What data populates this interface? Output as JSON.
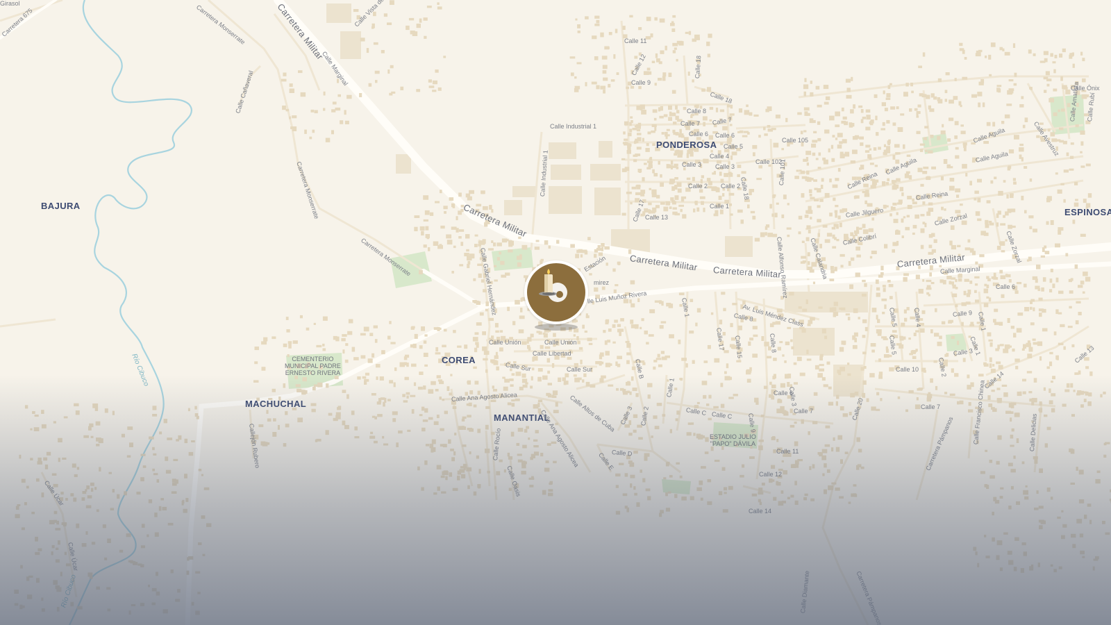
{
  "map": {
    "colors": {
      "land": "#f7f3ea",
      "road": "#ffffff",
      "road_minor": "#efe7d4",
      "building": "#e8dcc4",
      "park": "#d5e6c8",
      "river": "#a8d4df",
      "marker": "#8c6e3d"
    },
    "marker": {
      "icon": "candle-icon"
    },
    "barrios": [
      "BAJURA",
      "PONDEROSA",
      "ESPINOSA",
      "COREA",
      "MACHUCHAL",
      "MANANTIAL"
    ],
    "places": [
      "CEMENTERIO\nMUNICIPAL PADRE\nERNESTO RIVERA",
      "ESTADIO JULIO\n\"PAPO\" DÁVILA"
    ],
    "rivers": [
      "Río Cibuco",
      "Río Cibuco"
    ],
    "major_roads": [
      "Carretera Militar",
      "Carretera Militar",
      "Carretera Militar",
      "Carretera Militar",
      "Carretera Militar"
    ],
    "streets": [
      "Carretera 675",
      "Carretera Monserrate",
      "Calle Vista de",
      "Calle Marginal",
      "Calle Cañaveral",
      "Carretera Monserrate",
      "Carretera Monserrate",
      "Calle Industrial 1",
      "Calle Industrial 1",
      "Calle 11",
      "Calle 12",
      "Calle 9",
      "Calle 18",
      "Calle 18",
      "Calle 8",
      "Calle 7",
      "Calle 7",
      "Calle 6",
      "Calle 6",
      "Calle 5",
      "Calle 4",
      "Calle 3",
      "Calle 3",
      "Calle 2",
      "Calle 2",
      "Calle 1",
      "Calle 18",
      "Calle 105",
      "Calle 102",
      "Calle 101",
      "Calle 17",
      "Calle 13",
      "Calle Gabriel Hernández",
      "Estación",
      "mirez",
      "lle Luis Muñoz Rivera",
      "Av. Luis Méndez Class",
      "Calle 8",
      "Calle 1",
      "Calle 17",
      "Calle 15",
      "Calle 8",
      "Calle Unión",
      "Calle Unión",
      "Calle Libertad",
      "Calle Sur",
      "Calle Sur",
      "Calle B",
      "Calle Altos de Cuba",
      "Calle Ana Agosto Alicea",
      "Calle Ana Agosto Alicea",
      "Calle 3",
      "Calle 2",
      "Calle 1",
      "Calle C",
      "Calle C",
      "Calle 9",
      "Calle 6",
      "Calle 3",
      "Calle 7",
      "Calle D",
      "Calle E",
      "Calle 11",
      "Calle 12",
      "Calle 14",
      "Callejón Rubero",
      "Calle Rocío",
      "Calle Oasis",
      "Calle Úcar",
      "Calle Úcar",
      "Calle Marginal",
      "Calle 6",
      "Calle 5",
      "Calle 4",
      "Calle 5",
      "Calle 9",
      "Calle 1",
      "Calle 1",
      "Calle 2",
      "Calle 3",
      "Calle 10",
      "Calle 7",
      "Calle 14",
      "Calle 13",
      "Calle 20",
      "Carretera Pámpanos",
      "Carretera Pámpanos",
      "Calle Francisco Chinea",
      "Calle Delicias",
      "Calle Alfonso Ramírez",
      "Calle Calandria",
      "Calle Colibrí",
      "Calle Zorzal",
      "Calle Zorzal",
      "Calle Jilguero",
      "Calle Reina",
      "Calle Reina",
      "Calle Aguila",
      "Calle Aguila",
      "Calle Aguila",
      "Calle Avestruz",
      "Calle Amatista",
      "Calle Rubí",
      "Calle Ónix",
      "Calle Diamante",
      "Girasol"
    ]
  }
}
